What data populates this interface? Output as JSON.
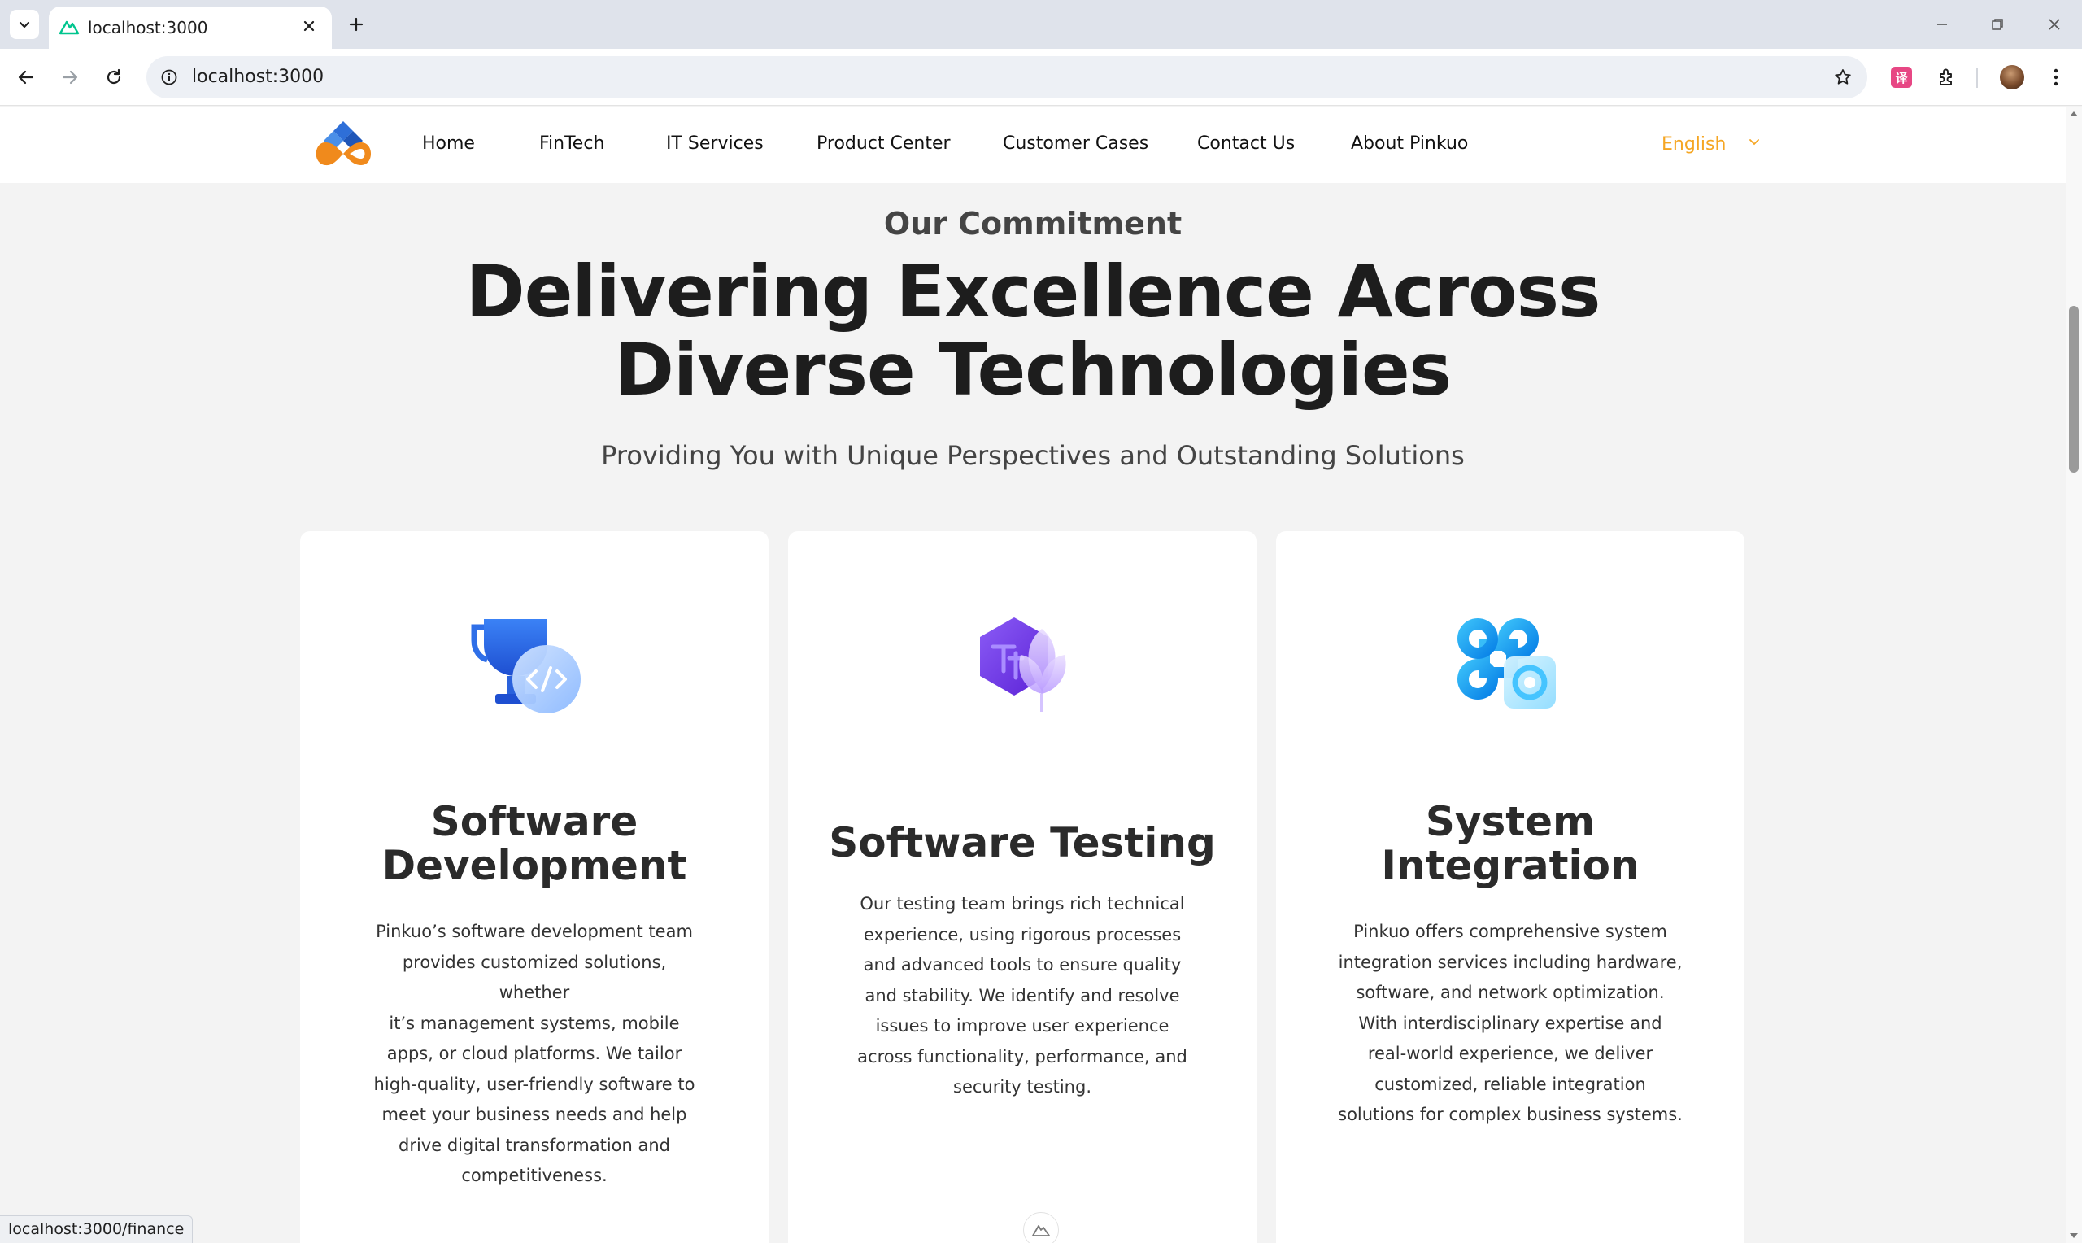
{
  "browser": {
    "tab_title": "localhost:3000",
    "url": "localhost:3000",
    "status_url": "localhost:3000/finance",
    "extension_badge": "译"
  },
  "nav": {
    "items": [
      {
        "label": "Home"
      },
      {
        "label": "FinTech"
      },
      {
        "label": "IT Services"
      },
      {
        "label": "Product Center"
      },
      {
        "label": "Customer Cases"
      },
      {
        "label": "Contact Us"
      },
      {
        "label": "About Pinkuo"
      }
    ],
    "language": "English"
  },
  "hero": {
    "eyebrow": "Our Commitment",
    "headline_line1": "Delivering Excellence Across",
    "headline_line2": "Diverse Technologies",
    "subheadline": "Providing You with Unique Perspectives and Outstanding Solutions"
  },
  "cards": [
    {
      "icon": "trophy-code-icon",
      "title_line1": "Software",
      "title_line2": "Development",
      "lines": [
        "Pinkuo’s software development team",
        "provides customized solutions, whether",
        "it’s management systems, mobile",
        "apps, or cloud platforms. We tailor",
        "high-quality, user-friendly software to",
        "meet your business needs and help",
        "drive digital transformation and",
        "competitiveness."
      ]
    },
    {
      "icon": "hexagon-leaf-icon",
      "title_line1": "Software Testing",
      "title_line2": "",
      "lines": [
        "Our testing team brings rich technical",
        "experience, using rigorous processes",
        "and advanced tools to ensure quality",
        "and stability. We identify and resolve",
        "issues to improve user experience",
        "across functionality, performance, and",
        "security testing."
      ]
    },
    {
      "icon": "command-gear-icon",
      "title_line1": "System",
      "title_line2": "Integration",
      "lines": [
        "Pinkuo offers comprehensive system",
        "integration services including hardware,",
        "software, and network optimization.",
        "With interdisciplinary expertise and",
        "real-world experience, we deliver",
        "customized, reliable integration",
        "solutions for complex business systems."
      ]
    }
  ],
  "colors": {
    "accent": "#f5a623",
    "page_bg": "#f3f3f3",
    "card_bg": "#ffffff",
    "heading": "#1d1d1d"
  }
}
